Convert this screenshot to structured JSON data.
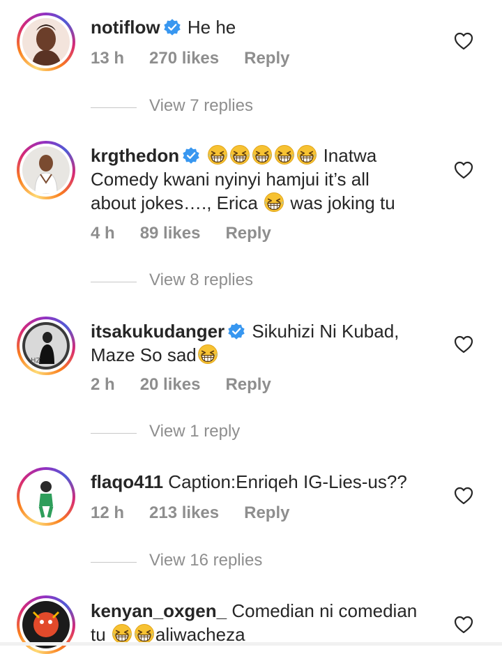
{
  "comments": [
    {
      "username": "notiflow",
      "verified": true,
      "text_line1": "He he",
      "time": "13 h",
      "likes": "270 likes",
      "reply_label": "Reply",
      "view_replies": "View 7 replies"
    },
    {
      "username": "krgthedon",
      "verified": true,
      "text_line1": "Inatwa",
      "text_line2": "Comedy kwani nyinyi hamjui it’s all",
      "text_line3a": "about jokes…., Erica",
      "text_line3b": "was joking tu",
      "time": "4 h",
      "likes": "89 likes",
      "reply_label": "Reply",
      "view_replies": "View 8 replies"
    },
    {
      "username": "itsakukudanger",
      "verified": true,
      "text_line1": "Sikuhizi Ni Kubad,",
      "text_line2": "Maze So sad",
      "time": "2 h",
      "likes": "20 likes",
      "reply_label": "Reply",
      "view_replies": "View 1 reply"
    },
    {
      "username": "flaqo411",
      "verified": false,
      "text_line1": "Caption:Enriqeh IG-Lies-us??",
      "time": "12 h",
      "likes": "213 likes",
      "reply_label": "Reply",
      "view_replies": "View 16 replies"
    },
    {
      "username": "kenyan_oxgen_",
      "verified": false,
      "text_line1": "Comedian ni comedian",
      "text_line2a": "tu",
      "text_line2b": "aliwacheza"
    }
  ],
  "icons": {
    "like": "heart-outline-icon",
    "verified": "verified-badge-icon",
    "emoji": "grinning-squinting-face-emoji"
  },
  "colors": {
    "verified_blue": "#3897f0",
    "meta_gray": "#8e8e8e",
    "text": "#262626"
  }
}
